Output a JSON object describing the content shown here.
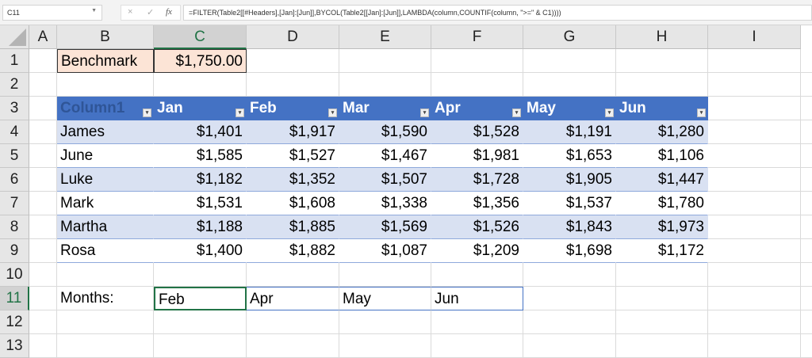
{
  "formula_bar": {
    "name_box": "C11",
    "cancel_icon": "×",
    "enter_icon": "✓",
    "fx_label": "fx",
    "formula": "=FILTER(Table2[[#Headers],[Jan]:[Jun]],BYCOL(Table2[[Jan]:[Jun]],LAMBDA(column,COUNTIF(column, \">=\" & C1))))"
  },
  "columns": [
    "A",
    "B",
    "C",
    "D",
    "E",
    "F",
    "G",
    "H",
    "I"
  ],
  "rows": [
    "1",
    "2",
    "3",
    "4",
    "5",
    "6",
    "7",
    "8",
    "9",
    "10",
    "11",
    "12",
    "13"
  ],
  "benchmark": {
    "label": "Benchmark",
    "value": "$1,750.00"
  },
  "table": {
    "headers": [
      "Column1",
      "Jan",
      "Feb",
      "Mar",
      "Apr",
      "May",
      "Jun"
    ],
    "rows": [
      [
        "James",
        "$1,401",
        "$1,917",
        "$1,590",
        "$1,528",
        "$1,191",
        "$1,280"
      ],
      [
        "June",
        "$1,585",
        "$1,527",
        "$1,467",
        "$1,981",
        "$1,653",
        "$1,106"
      ],
      [
        "Luke",
        "$1,182",
        "$1,352",
        "$1,507",
        "$1,728",
        "$1,905",
        "$1,447"
      ],
      [
        "Mark",
        "$1,531",
        "$1,608",
        "$1,338",
        "$1,356",
        "$1,537",
        "$1,780"
      ],
      [
        "Martha",
        "$1,188",
        "$1,885",
        "$1,569",
        "$1,526",
        "$1,843",
        "$1,973"
      ],
      [
        "Rosa",
        "$1,400",
        "$1,882",
        "$1,087",
        "$1,209",
        "$1,698",
        "$1,172"
      ]
    ]
  },
  "months": {
    "label": "Months:",
    "values": [
      "Feb",
      "Apr",
      "May",
      "Jun"
    ]
  }
}
